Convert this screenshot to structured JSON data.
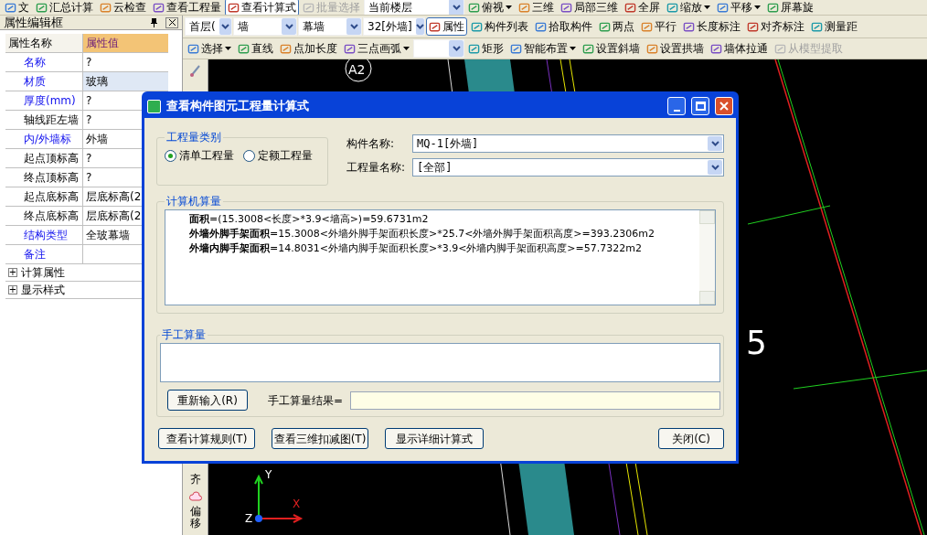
{
  "toolbar_top": [
    {
      "kind": "button",
      "label": "文",
      "selected": false,
      "disabled": false,
      "menu": false
    },
    {
      "kind": "button",
      "label": "汇总计算",
      "selected": false,
      "disabled": false,
      "menu": false
    },
    {
      "kind": "button",
      "label": "云检查",
      "selected": false,
      "disabled": false,
      "menu": false
    },
    {
      "kind": "button",
      "label": "查看工程量",
      "selected": false,
      "disabled": false,
      "menu": false
    },
    {
      "kind": "button",
      "label": "查看计算式",
      "selected": true,
      "disabled": false,
      "menu": false
    },
    {
      "kind": "button",
      "label": "批量选择",
      "selected": false,
      "disabled": true,
      "menu": false
    },
    {
      "kind": "combo",
      "value": "当前楼层"
    },
    {
      "kind": "button",
      "label": "俯视",
      "selected": false,
      "disabled": false,
      "menu": true
    },
    {
      "kind": "button",
      "label": "三维",
      "selected": false,
      "disabled": false,
      "menu": false
    },
    {
      "kind": "button",
      "label": "局部三维",
      "selected": false,
      "disabled": false,
      "menu": false
    },
    {
      "kind": "button",
      "label": "全屏",
      "selected": false,
      "disabled": false,
      "menu": false
    },
    {
      "kind": "button",
      "label": "缩放",
      "selected": false,
      "disabled": false,
      "menu": true
    },
    {
      "kind": "button",
      "label": "平移",
      "selected": false,
      "disabled": false,
      "menu": true
    },
    {
      "kind": "button",
      "label": "屏幕旋",
      "selected": false,
      "disabled": false,
      "menu": false
    }
  ],
  "property_panel": {
    "title": "属性编辑框",
    "columns": [
      "属性名称",
      "属性值"
    ],
    "rows": [
      {
        "kind": "field",
        "name": "名称",
        "value": "?",
        "public": true,
        "selected": false
      },
      {
        "kind": "field",
        "name": "材质",
        "value": "玻璃",
        "public": true,
        "selected": true
      },
      {
        "kind": "field",
        "name": "厚度(mm)",
        "value": "?",
        "public": true,
        "selected": false
      },
      {
        "kind": "field",
        "name": "轴线距左墙",
        "value": "?",
        "public": false,
        "selected": false
      },
      {
        "kind": "field",
        "name": "内/外墙标",
        "value": "外墙",
        "public": true,
        "selected": false
      },
      {
        "kind": "field",
        "name": "起点顶标高",
        "value": "?",
        "public": false,
        "selected": false
      },
      {
        "kind": "field",
        "name": "终点顶标高",
        "value": "?",
        "public": false,
        "selected": false
      },
      {
        "kind": "field",
        "name": "起点底标高",
        "value": "层底标高(2",
        "public": false,
        "selected": false
      },
      {
        "kind": "field",
        "name": "终点底标高",
        "value": "层底标高(2",
        "public": false,
        "selected": false
      },
      {
        "kind": "field",
        "name": "结构类型",
        "value": "全玻幕墙",
        "public": true,
        "selected": false
      },
      {
        "kind": "field",
        "name": "备注",
        "public": true,
        "selected": false
      },
      {
        "kind": "group",
        "name": "计算属性",
        "expand_sign": "+"
      },
      {
        "kind": "group",
        "name": "显示样式",
        "expand_sign": "+"
      }
    ]
  },
  "toolbar_2": [
    {
      "kind": "combo",
      "value": "首层("
    },
    {
      "kind": "combo",
      "value": "墙"
    },
    {
      "kind": "combo",
      "value": "幕墙"
    },
    {
      "kind": "combo",
      "value": "32[外墙]"
    },
    {
      "kind": "button",
      "label": "属性",
      "selected": true,
      "disabled": false,
      "menu": false
    },
    {
      "kind": "button",
      "label": "构件列表",
      "selected": false,
      "disabled": false,
      "menu": false
    },
    {
      "kind": "button",
      "label": "拾取构件",
      "selected": false,
      "disabled": false,
      "menu": false
    },
    {
      "kind": "button",
      "label": "两点",
      "selected": false,
      "disabled": false,
      "menu": false
    },
    {
      "kind": "button",
      "label": "平行",
      "selected": false,
      "disabled": false,
      "menu": false
    },
    {
      "kind": "button",
      "label": "长度标注",
      "selected": false,
      "disabled": false,
      "menu": false
    },
    {
      "kind": "button",
      "label": "对齐标注",
      "selected": false,
      "disabled": false,
      "menu": false
    },
    {
      "kind": "button",
      "label": "测量距",
      "selected": false,
      "disabled": false,
      "menu": false
    }
  ],
  "toolbar_3": [
    {
      "kind": "button",
      "label": "选择",
      "selected": false,
      "disabled": false,
      "menu": true
    },
    {
      "kind": "button",
      "label": "直线",
      "selected": false,
      "disabled": false,
      "menu": false
    },
    {
      "kind": "button",
      "label": "点加长度",
      "selected": false,
      "disabled": false,
      "menu": false
    },
    {
      "kind": "button",
      "label": "三点画弧",
      "selected": false,
      "disabled": false,
      "menu": true
    },
    {
      "kind": "combo"
    },
    {
      "kind": "button",
      "label": "矩形",
      "selected": false,
      "disabled": false,
      "menu": false
    },
    {
      "kind": "button",
      "label": "智能布置",
      "selected": false,
      "disabled": false,
      "menu": true
    },
    {
      "kind": "button",
      "label": "设置斜墙",
      "selected": false,
      "disabled": false,
      "menu": false
    },
    {
      "kind": "button",
      "label": "设置拱墙",
      "selected": false,
      "disabled": false,
      "menu": false
    },
    {
      "kind": "button",
      "label": "墙体拉通",
      "selected": false,
      "disabled": false,
      "menu": false
    },
    {
      "kind": "button",
      "label": "从模型提取",
      "selected": false,
      "disabled": true,
      "menu": false
    }
  ],
  "side_strip": [
    "齐",
    "偏移"
  ],
  "canvas": {
    "labels": [
      "A2",
      "5"
    ],
    "axes": [
      "Y",
      "X",
      "Z"
    ]
  },
  "dialog": {
    "title": "查看构件图元工程量计算式",
    "category": {
      "title": "工程量类别",
      "options": [
        {
          "label": "清单工程量",
          "selected": true
        },
        {
          "label": "定额工程量",
          "selected": false
        }
      ]
    },
    "fields": [
      {
        "label": "构件名称:",
        "value": "MQ-1[外墙]"
      },
      {
        "label": "工程量名称:",
        "value": "[全部]"
      }
    ],
    "computed": {
      "title": "计算机算量",
      "lines": [
        "**面积**=(15.3008<长度>*3.9<墙高>)=59.6731m2",
        "**外墙外脚手架面积**=15.3008<外墙外脚手架面积长度>*25.7<外墙外脚手架面积高度>=393.2306m2",
        "**外墙内脚手架面积**=14.8031<外墙内脚手架面积长度>*3.9<外墙内脚手架面积高度>=57.7322m2"
      ]
    },
    "manual": {
      "title": "手工算量",
      "reset_button": "重新输入(R)",
      "result_label": "手工算量结果="
    },
    "buttons": [
      "查看计算规则(T)",
      "查看三维扣减图(T)",
      "显示详细计算式"
    ],
    "close_button": "关闭(C)"
  }
}
